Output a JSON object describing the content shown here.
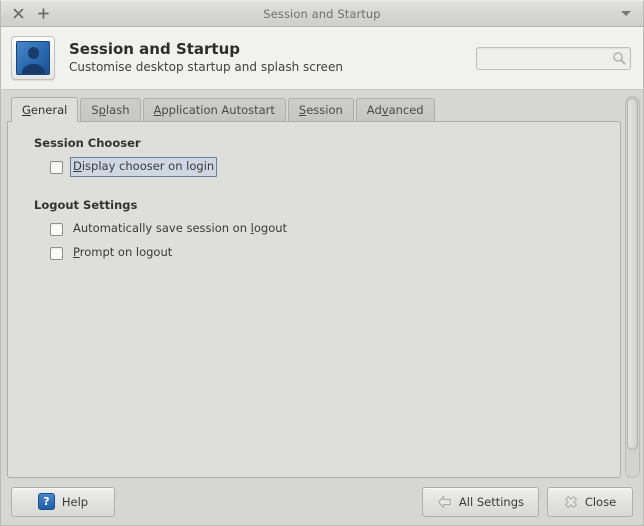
{
  "titlebar": {
    "title": "Session and Startup",
    "close_icon": "close-icon",
    "new_tab_icon": "plus-icon",
    "menu_icon": "chevron-down-icon"
  },
  "header": {
    "icon": "user-session-icon",
    "title": "Session and Startup",
    "subtitle": "Customise desktop startup and splash screen",
    "search": {
      "value": "",
      "placeholder": "",
      "icon": "search-icon"
    }
  },
  "tabs": [
    {
      "label": "General",
      "mnemonic_before": "",
      "mnemonic": "G",
      "mnemonic_after": "eneral",
      "active": true
    },
    {
      "label": "Splash",
      "mnemonic_before": "S",
      "mnemonic": "p",
      "mnemonic_after": "lash",
      "active": false
    },
    {
      "label": "Application Autostart",
      "mnemonic_before": "",
      "mnemonic": "A",
      "mnemonic_after": "pplication Autostart",
      "active": false
    },
    {
      "label": "Session",
      "mnemonic_before": "",
      "mnemonic": "S",
      "mnemonic_after": "ession",
      "active": false
    },
    {
      "label": "Advanced",
      "mnemonic_before": "Ad",
      "mnemonic": "v",
      "mnemonic_after": "anced",
      "active": false
    }
  ],
  "general_page": {
    "groups": [
      {
        "title": "Session Chooser",
        "options": [
          {
            "label": "Display chooser on login",
            "mnemonic_before": "",
            "mnemonic": "D",
            "mnemonic_after": "isplay chooser on login",
            "checked": false,
            "focused": true
          }
        ]
      },
      {
        "title": "Logout Settings",
        "options": [
          {
            "label": "Automatically save session on logout",
            "mnemonic_before": "Automatically save session on ",
            "mnemonic": "l",
            "mnemonic_after": "ogout",
            "checked": false,
            "focused": false
          },
          {
            "label": "Prompt on logout",
            "mnemonic_before": "",
            "mnemonic": "P",
            "mnemonic_after": "rompt on logout",
            "checked": false,
            "focused": false
          }
        ]
      }
    ]
  },
  "buttonbar": {
    "help": {
      "label": "Help",
      "icon": "help-icon"
    },
    "all_settings": {
      "label": "All Settings",
      "icon": "back-arrow-icon"
    },
    "close": {
      "label": "Close",
      "icon": "close-icon"
    }
  },
  "colors": {
    "accent_blue": "#2f6fb5",
    "focus_border": "#6a7d99",
    "focus_fill": "#cfd7e3",
    "window_bg": "#d6d6d2",
    "page_bg": "#dededa",
    "header_bg": "#f1f1ef"
  }
}
